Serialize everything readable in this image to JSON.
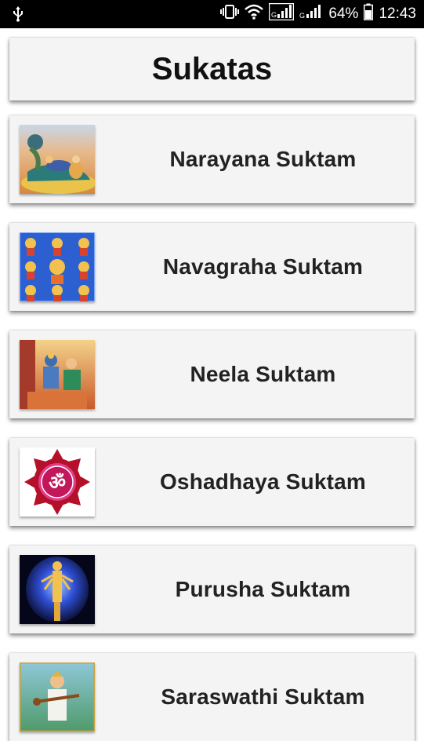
{
  "status_bar": {
    "usb_icon": "usb-icon",
    "battery_percent": "64%",
    "time": "12:43"
  },
  "header": {
    "title": "Sukatas"
  },
  "items": [
    {
      "label": "Narayana Suktam",
      "image": "narayana-image"
    },
    {
      "label": "Navagraha Suktam",
      "image": "navagraha-image"
    },
    {
      "label": "Neela Suktam",
      "image": "neela-image"
    },
    {
      "label": "Oshadhaya Suktam",
      "image": "om-image"
    },
    {
      "label": "Purusha Suktam",
      "image": "purusha-image"
    },
    {
      "label": "Saraswathi Suktam",
      "image": "saraswathi-image"
    }
  ]
}
